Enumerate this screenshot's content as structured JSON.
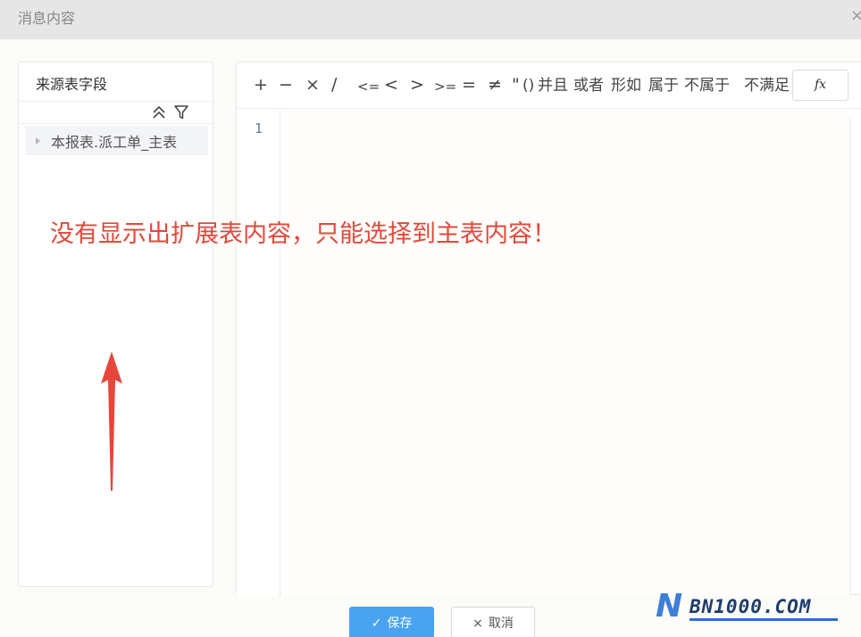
{
  "dialog": {
    "title": "消息内容",
    "close_glyph": "×"
  },
  "left_panel": {
    "header": "来源表字段",
    "tools": [
      "collapse-all-icon",
      "filter-icon"
    ],
    "tree": [
      {
        "label": "本报表.派工单_主表",
        "expanded": false
      }
    ]
  },
  "toolbar": {
    "operators": [
      "+",
      "−",
      "×",
      "∕",
      "<=",
      "<",
      ">",
      ">=",
      "=",
      "≠",
      "\"",
      "()"
    ],
    "keywords": [
      "并且",
      "或者",
      "形如",
      "属于",
      "不属于",
      "不满足"
    ],
    "fx_label": "fx"
  },
  "editor": {
    "line_numbers": [
      "1"
    ],
    "content": ""
  },
  "annotation": {
    "text": "没有显示出扩展表内容，只能选择到主表内容！",
    "color": "#e04a3a"
  },
  "footer": {
    "save_label": "保存",
    "save_icon": "✓",
    "cancel_label": "取消",
    "cancel_icon": "×"
  },
  "watermark": {
    "logo_letter": "N",
    "text": "BN1000.COM"
  },
  "colors": {
    "accent": "#4aa3f0",
    "annotation_red": "#e04a3a",
    "watermark_blue": "#3d7fd8"
  }
}
